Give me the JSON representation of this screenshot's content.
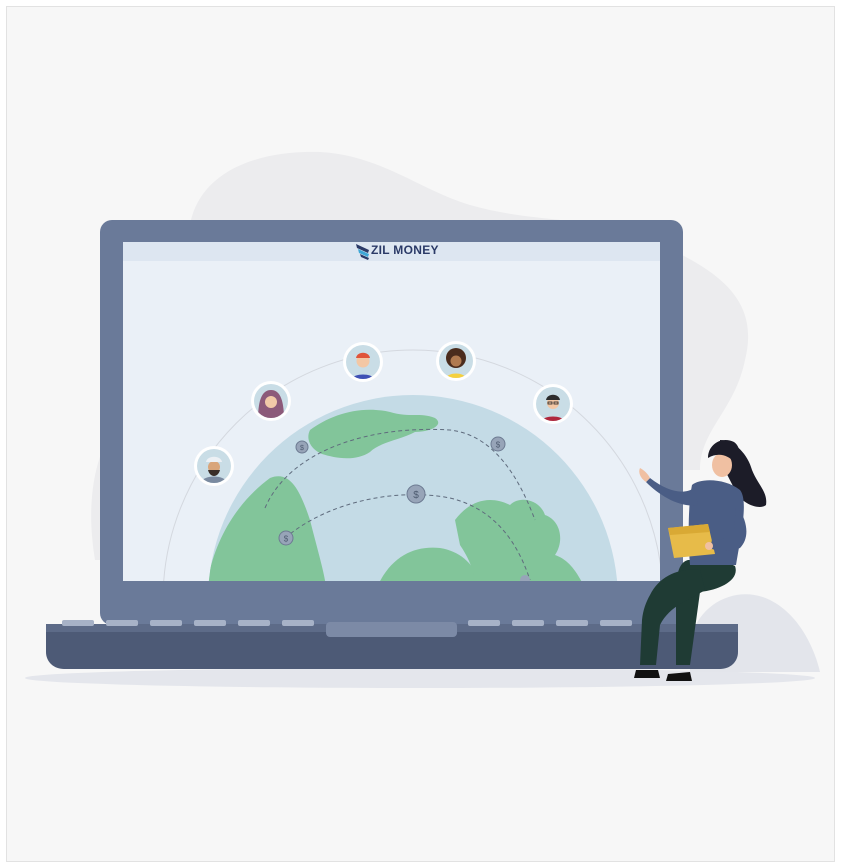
{
  "brand": {
    "name": "ZIL MONEY",
    "logo_icon": "wing-icon",
    "color": "#2b3a67",
    "accent": "#3fa7d6"
  },
  "illustration": {
    "people_avatars": [
      "man-turban-icon",
      "woman-hijab-icon",
      "man-red-hair-icon",
      "woman-afro-icon",
      "man-glasses-icon"
    ],
    "currency_icon": "dollar-coin-icon",
    "presenter": "woman-presenting-icon",
    "colors": {
      "laptop_frame": "#6a7a99",
      "laptop_base": "#4d5a76",
      "screen_bg": "#eaf0f7",
      "globe_ocean": "#c4dbe6",
      "land": "#82c59a",
      "backdrop_blob": "#ececee"
    }
  }
}
